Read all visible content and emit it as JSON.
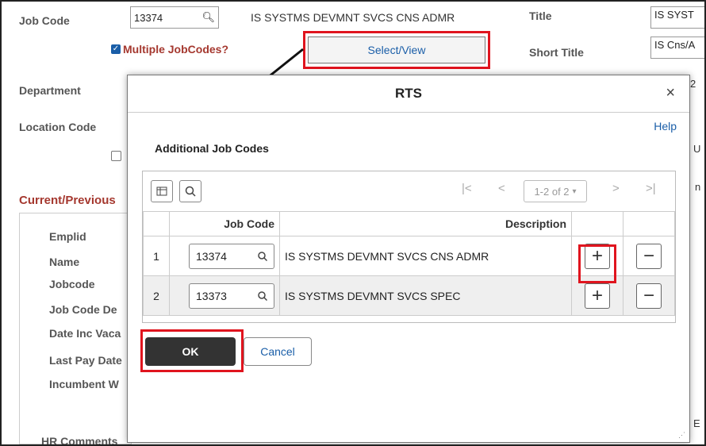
{
  "background": {
    "job_code_label": "Job Code",
    "job_code_value": "13374",
    "job_code_desc": "IS SYSTMS DEVMNT SVCS CNS ADMR",
    "multiple_jobcodes_label": "Multiple JobCodes?",
    "select_view_label": "Select/View",
    "title_label": "Title",
    "title_value": "IS SYST",
    "short_title_label": "Short Title",
    "short_title_value": "IS Cns/A",
    "department_label": "Department",
    "location_code_label": "Location Code",
    "section_heading": "Current/Previous",
    "emplid_label": "Emplid",
    "name_label": "Name",
    "jobcode_label": "Jobcode",
    "job_code_de_label": "Job Code De",
    "date_inc_vaca_label": "Date Inc Vaca",
    "last_pay_date_label": "Last Pay Date",
    "incumbent_label": "Incumbent W",
    "hr_comments_label": "HR Comments",
    "right_partial_1": "2",
    "right_partial_2": "U",
    "right_partial_3": "n",
    "right_partial_4": "E"
  },
  "modal": {
    "title": "RTS",
    "close_label": "×",
    "help_label": "Help",
    "section_title": "Additional Job Codes",
    "pagination": {
      "first": "|<",
      "prev": "<",
      "range": "1-2 of 2",
      "next": ">",
      "last": ">|"
    },
    "columns": [
      "",
      "Job Code",
      "Description",
      "",
      ""
    ],
    "rows": [
      {
        "index": "1",
        "job_code": "13374",
        "description": "IS SYSTMS DEVMNT SVCS CNS ADMR"
      },
      {
        "index": "2",
        "job_code": "13373",
        "description": "IS SYSTMS DEVMNT SVCS SPEC"
      }
    ],
    "ok_label": "OK",
    "cancel_label": "Cancel"
  },
  "colors": {
    "highlight": "#e0141e",
    "link": "#1a5ea8",
    "primary_button": "#333333",
    "section_heading": "#a5382f"
  }
}
